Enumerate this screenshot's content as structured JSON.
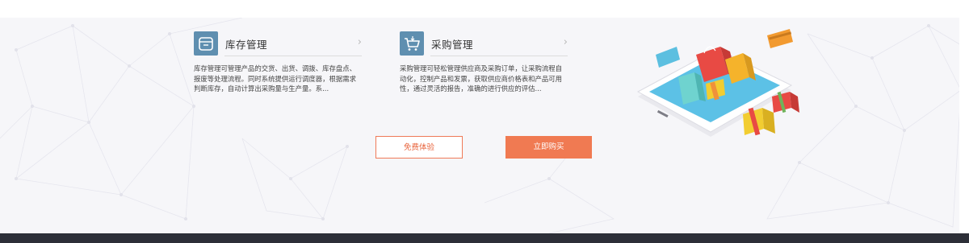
{
  "cards": [
    {
      "title": "库存管理",
      "icon": "inventory-box-icon",
      "description": "库存管理可管理产品的交货、出货、调拨、库存盘点、报废等处理流程。同时系统提供运行调度器，根据需求判断库存，自动计算出采购量与生产量。系..."
    },
    {
      "title": "采购管理",
      "icon": "shopping-cart-icon",
      "description": "采购管理可轻松管理供应商及采购订单，让采购流程自动化，控制产品和发票，获取供应商价格表和产品可用性，通过灵活的报告，准确的进行供应的评估..."
    }
  ],
  "buttons": {
    "trial": "免费体验",
    "buy": "立即购买"
  },
  "colors": {
    "accent": "#f07a52",
    "icon_bg": "#5f8fb0",
    "content_bg": "#f6f6f9",
    "footer_bg": "#2d2f38"
  }
}
